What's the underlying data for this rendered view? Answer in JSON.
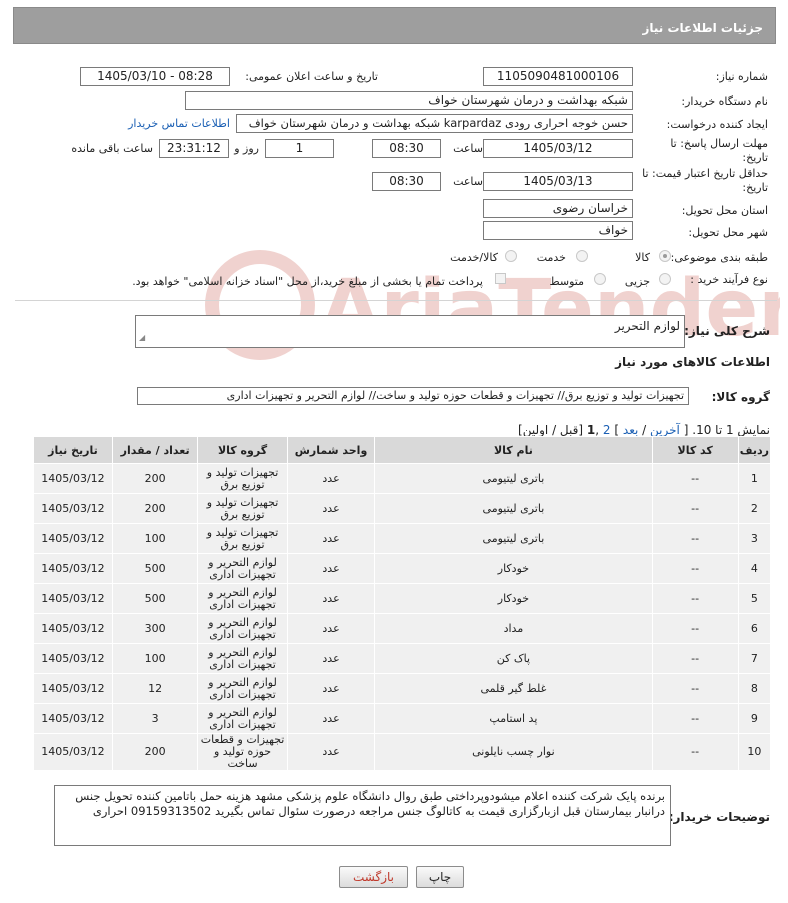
{
  "header": {
    "title": "جزئیات اطلاعات نیاز"
  },
  "form": {
    "need_number_label": "شماره نیاز:",
    "need_number": "1105090481000106",
    "announce_label": "تاریخ و ساعت اعلان عمومی:",
    "announce_value": "1405/03/10 - 08:28",
    "buyer_label": "نام دستگاه خریدار:",
    "buyer_value": "شبکه بهداشت و درمان شهرستان خواف",
    "requester_label": "ایجاد کننده درخواست:",
    "requester_value": "حسن خوجه احراری رودی karpardaz شبکه بهداشت و درمان شهرستان خواف",
    "contact_link": "اطلاعات تماس خریدار",
    "deadline_label": "مهلت ارسال پاسخ: تا تاریخ:",
    "deadline_date": "1405/03/12",
    "time_label": "ساعت",
    "deadline_time": "08:30",
    "days_value": "1",
    "days_label": "روز و",
    "remaining_value": "23:31:12",
    "remaining_label": "ساعت باقی مانده",
    "price_deadline_label": "حداقل تاریخ اعتبار قیمت: تا تاریخ:",
    "price_date": "1405/03/13",
    "price_time": "08:30",
    "province_label": "استان محل تحویل:",
    "province_value": "خراسان رضوی",
    "city_label": "شهر محل تحویل:",
    "city_value": "خواف",
    "category_label": "طبقه بندی موضوعی:",
    "category_options": [
      "کالا",
      "خدمت",
      "کالا/خدمت"
    ],
    "category_selected": "کالا",
    "process_label": "نوع فرآیند خرید :",
    "process_options": [
      "جزیی",
      "متوسط"
    ],
    "process_note": "پرداخت تمام یا بخشی از مبلغ خرید،از محل \"اسناد خزانه اسلامی\" خواهد بود."
  },
  "summary": {
    "label": "شرح کلی نیاز:",
    "value": "لوازم التحریر"
  },
  "goods_section_title": "اطلاعات کالاهای مورد نیاز",
  "goods_group": {
    "label": "گروه کالا:",
    "value": "تجهیزات تولید و توزیع برق// تجهیزات و قطعات حوزه تولید و ساخت// لوازم التحریر و تجهیزات اداری"
  },
  "pager": {
    "show": "نمایش 1 تا 10.",
    "bracket_open": "[",
    "last": "آخرین",
    "slash1": "/",
    "next": "بعد",
    "bracket_close": "]",
    "page2": "2",
    "comma": ",",
    "page1": "1",
    "prev_first": "[قبل / اولین]"
  },
  "table": {
    "headers": [
      "ردیف",
      "کد کالا",
      "نام کالا",
      "واحد شمارش",
      "گروه کالا",
      "تعداد / مقدار",
      "تاریخ نیاز"
    ],
    "rows": [
      [
        "1",
        "--",
        "باتری لیتیومی",
        "عدد",
        "تجهیزات تولید و توزیع برق",
        "200",
        "1405/03/12"
      ],
      [
        "2",
        "--",
        "باتری لیتیومی",
        "عدد",
        "تجهیزات تولید و توزیع برق",
        "200",
        "1405/03/12"
      ],
      [
        "3",
        "--",
        "باتری لیتیومی",
        "عدد",
        "تجهیزات تولید و توزیع برق",
        "100",
        "1405/03/12"
      ],
      [
        "4",
        "--",
        "خودکار",
        "عدد",
        "لوازم التحریر و تجهیزات اداری",
        "500",
        "1405/03/12"
      ],
      [
        "5",
        "--",
        "خودکار",
        "عدد",
        "لوازم التحریر و تجهیزات اداری",
        "500",
        "1405/03/12"
      ],
      [
        "6",
        "--",
        "مداد",
        "عدد",
        "لوازم التحریر و تجهیزات اداری",
        "300",
        "1405/03/12"
      ],
      [
        "7",
        "--",
        "پاک کن",
        "عدد",
        "لوازم التحریر و تجهیزات اداری",
        "100",
        "1405/03/12"
      ],
      [
        "8",
        "--",
        "غلط گیر قلمی",
        "عدد",
        "لوازم التحریر و تجهیزات اداری",
        "12",
        "1405/03/12"
      ],
      [
        "9",
        "--",
        "پد استامپ",
        "عدد",
        "لوازم التحریر و تجهیزات اداری",
        "3",
        "1405/03/12"
      ],
      [
        "10",
        "--",
        "نوار چسب نایلونی",
        "عدد",
        "تجهیزات و قطعات حوزه تولید و ساخت",
        "200",
        "1405/03/12"
      ]
    ]
  },
  "buyer_notes": {
    "label": "توضیحات خریدار:",
    "value": "برنده پایک شرکت کننده اعلام میشودوپرداختی طبق روال دانشگاه علوم پزشکی مشهد هزینه حمل باتامین کننده تحویل جنس درانبار بیمارستان قبل ازبارگزاری قیمت به کاتالوگ جنس مراجعه درصورت سئوال تماس بگیرید 09159313502 احراری"
  },
  "buttons": {
    "print": "چاپ",
    "back": "بازگشت"
  },
  "colors": {
    "header_bg": "#9e9e9e",
    "link": "#1a5fb4",
    "back_text": "#c0392b"
  },
  "watermark_text": "AriaTender.neT"
}
